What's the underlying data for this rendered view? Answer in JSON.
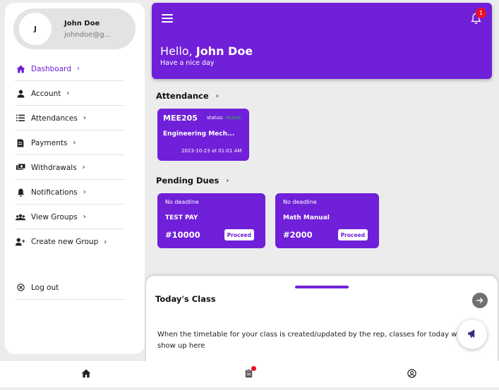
{
  "profile": {
    "initial": "J",
    "name": "John Doe",
    "email": "johndoe@g..."
  },
  "sidebar": {
    "items": [
      {
        "label": "Dashboard",
        "icon": "home-icon",
        "active": true
      },
      {
        "label": "Account",
        "icon": "person-icon"
      },
      {
        "label": "Attendances",
        "icon": "list-icon"
      },
      {
        "label": "Payments",
        "icon": "receipt-icon"
      },
      {
        "label": "Withdrawals",
        "icon": "money-icon"
      },
      {
        "label": "Notifications",
        "icon": "bell-icon"
      },
      {
        "label": "View Groups",
        "icon": "groups-icon"
      },
      {
        "label": "Create new Group",
        "icon": "add-person-icon"
      }
    ],
    "logout_label": "Log out"
  },
  "header": {
    "greeting_prefix": "Hello,",
    "greeting_name": "John Doe",
    "subtitle": "Have a nice day",
    "notification_count": "1"
  },
  "attendance": {
    "title": "Attendance",
    "cards": [
      {
        "code": "MEE205",
        "status_label": "status:",
        "status": "Active",
        "name": "Engineering Mech...",
        "datetime": "2023-10-23 at 01:01 AM"
      }
    ]
  },
  "dues": {
    "title": "Pending Dues",
    "cards": [
      {
        "deadline": "No deadline",
        "name": "TEST PAY",
        "amount": "#10000",
        "button": "Proceed"
      },
      {
        "deadline": "No deadline",
        "name": "Math Manual",
        "amount": "#2000",
        "button": "Proceed"
      }
    ]
  },
  "todays_class": {
    "title": "Today's Class",
    "message": "When the timetable for your class is created/updated by the rep, classes for today will show up here"
  },
  "colors": {
    "accent": "#7020d8",
    "badge": "#e8102a",
    "status_active": "#2bbb3a"
  }
}
